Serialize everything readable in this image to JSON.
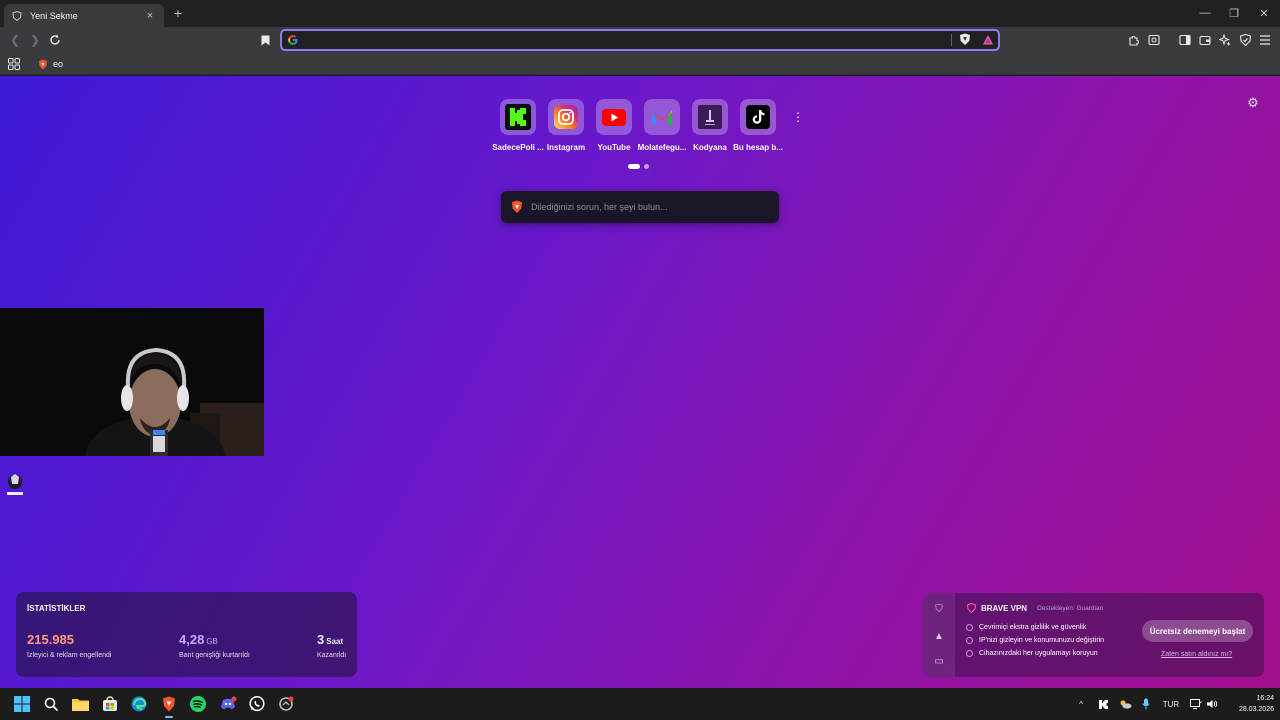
{
  "tab": {
    "title": "Yeni Sekme",
    "close": "×",
    "new": "+"
  },
  "window": {
    "minimize": "—",
    "restore": "❐",
    "close": "✕"
  },
  "urlbar": {
    "value": "",
    "placeholder": ""
  },
  "bookmarks": {
    "items": [
      {
        "label": "eo"
      }
    ]
  },
  "topsites": [
    {
      "label": "SadecePoli ...",
      "icon": "kick-icon",
      "color": "#53fc18"
    },
    {
      "label": "Instagram",
      "icon": "instagram-icon",
      "color": "#e1306c"
    },
    {
      "label": "YouTube",
      "icon": "youtube-icon",
      "color": "#ff0000"
    },
    {
      "label": "Molatefegu...",
      "icon": "gmail-icon",
      "color": "#ea4335"
    },
    {
      "label": "Kodyana",
      "icon": "kodyana-icon",
      "color": "#3b1c52"
    },
    {
      "label": "Bu hesap b...",
      "icon": "tiktok-icon",
      "color": "#000000"
    }
  ],
  "search": {
    "placeholder": "Dilediğinizi sorun, her şeyi bulun..."
  },
  "stats": {
    "header": "İSTATİSTİKLER",
    "blocked": {
      "value": "215.985",
      "desc": "İzleyici & reklam engellendi",
      "color": "#ff9a7a"
    },
    "bandwidth": {
      "value": "4,28",
      "unit": "GB",
      "desc": "Bant genişliği kurtarıldı",
      "color": "#c9a8ff"
    },
    "time": {
      "value": "3",
      "unit": "Saat",
      "desc": "Kazanıldı",
      "color": "#ffffff"
    }
  },
  "vpn": {
    "title": "BRAVE VPN",
    "by": "Destekleyen: Guardian",
    "features": [
      "Çevrimiçi ekstra gizlilik ve güvenlik",
      "IP'nizi gizleyin ve konumunuzu değiştirin",
      "Cihazınızdaki her uygulamayı koruyun"
    ],
    "cta": "Ücretsiz denemeyi başlat",
    "link": "Zaten satın aldınız mı?"
  },
  "taskbar": {
    "lang": "TUR",
    "time": "16:24",
    "date": "28.03.2026"
  }
}
